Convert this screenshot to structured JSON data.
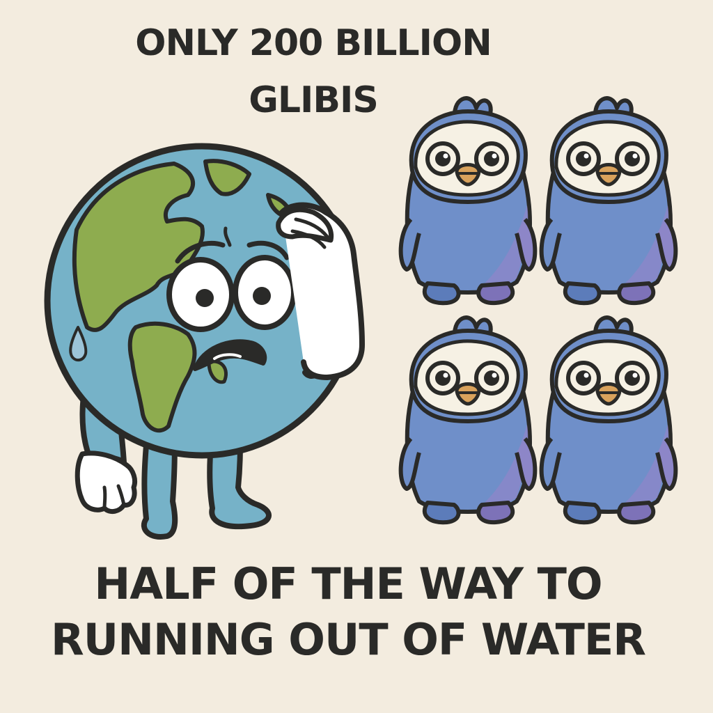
{
  "meme": {
    "top_caption": {
      "line1": "ONLY 200 BILLION",
      "line2": "GLIBIS"
    },
    "bottom_caption": {
      "line1": "HALF OF THE WAY TO",
      "line2": "RUNNING OUT OF WATER"
    }
  },
  "colors": {
    "background": "#f3ecdf",
    "outline": "#2a2a28",
    "ocean": "#76b2c8",
    "land": "#8eac4f",
    "glibi_blue": "#6f8fc9",
    "glibi_purple": "#8d86c8",
    "beak": "#d9a25c",
    "face": "#f6f1e4"
  },
  "icons": [
    "worried-earth-icon",
    "sweat-drop-icon",
    "glibi-creature-icon"
  ]
}
